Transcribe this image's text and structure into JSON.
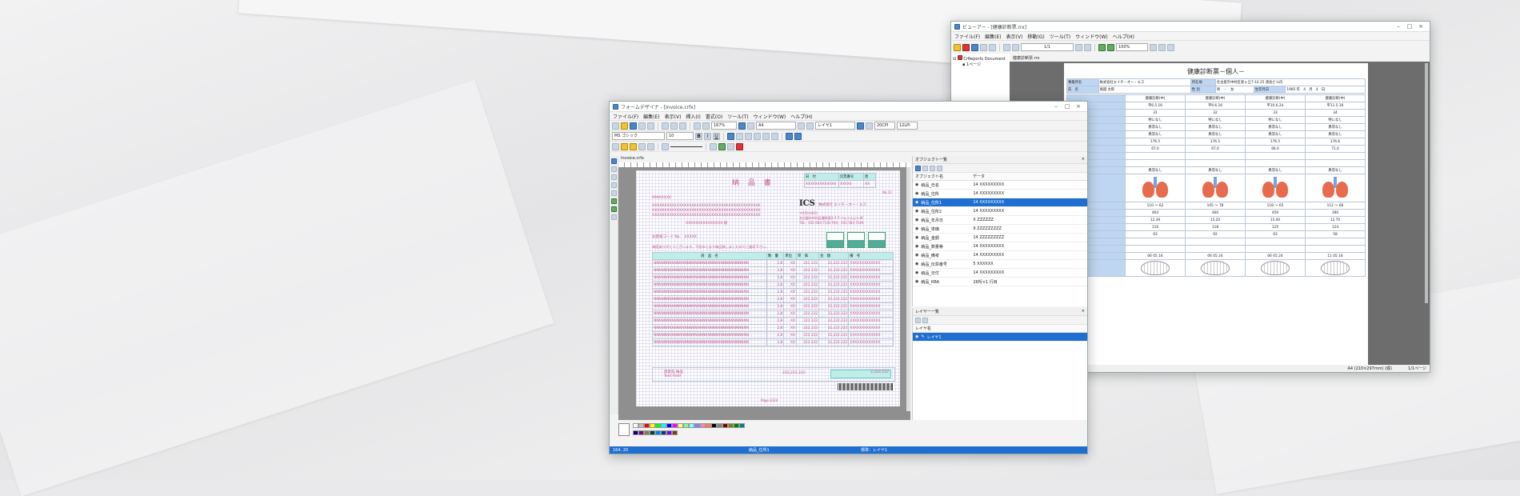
{
  "viewer": {
    "title": "ビューアー - [健康診断票.rrx]",
    "menu": [
      "ファイル(F)",
      "編集(E)",
      "表示(V)",
      "移動(G)",
      "ツール(T)",
      "ウィンドウ(W)",
      "ヘルプ(H)"
    ],
    "page_indicator": "1/1",
    "zoom": "100%",
    "tree_root": "CrReports Document",
    "tree_child": "1ページ",
    "tab": "健康診断票.rrx",
    "doc_title": "健康診断票－個人－",
    "company_label": "事業所名",
    "company": "株式会社エイチ・オー・エス",
    "address_label": "所在地",
    "address": "名古屋市中村区者ヶ丘7-10 25 渡会ビル内",
    "name_label": "氏　名",
    "name": "堀越 太郎",
    "sex_label": "性 別",
    "sex": "男　・　女",
    "birth_label": "生年月日",
    "birth": "1985 年　4　月　4　日",
    "columns": [
      "健康診断(中)",
      "健康診断(中)",
      "健康診断(中)",
      "健康診断(中)"
    ],
    "dates": [
      "平6.5.16",
      "平9.6.16",
      "平10.6.24",
      "平11.5.16"
    ],
    "ages": [
      "31",
      "32",
      "33",
      "34"
    ],
    "nashi": "特になし",
    "ijo": "異常なし",
    "heights": [
      "176.5",
      "176.5",
      "176.5",
      "176.6"
    ],
    "weights": [
      "67.0",
      "67.0",
      "66.0",
      "71.0"
    ],
    "bp": [
      "110 ～ 62",
      "105 ～ 78",
      "118 ～ 65",
      "112 ～ 66"
    ],
    "chol": [
      "464",
      "460",
      "450",
      "390"
    ],
    "tg": [
      "12.39",
      "15.20",
      "15.00",
      "12.70"
    ],
    "ldl": [
      "116",
      "118",
      "125",
      "124"
    ],
    "hdl": [
      "93",
      "92",
      "93",
      "58"
    ],
    "dental_dates": [
      "06 05 16",
      "06 05 24",
      "06 05 24",
      "11 05 16"
    ],
    "status_left": "A4 (210×297mm) (縦)",
    "status_right": "1/1ページ"
  },
  "designer": {
    "title": "フォームデザイナ - [Invoice.crfx]",
    "menu": [
      "ファイル(F)",
      "編集(E)",
      "表示(V)",
      "挿入(I)",
      "書式(O)",
      "ツール(T)",
      "ウィンドウ(W)",
      "ヘルプ(H)"
    ],
    "zoom": "167%",
    "paper": "A4",
    "layer": "レイヤ1",
    "font": "MS ゴシック",
    "font_size": "10",
    "cpi": "20CPI",
    "lpi": "12LPI",
    "tab": "Invoice.crfx",
    "form_title": "納 品 書",
    "header_cols": [
      "日　付",
      "伝票番号",
      "頁"
    ],
    "header_vals": [
      "XXXXXXXXXXXXX",
      "XXXXX",
      "XX"
    ],
    "page_no": "No.12",
    "customer_no": "999XXXXX",
    "xline": "XXXXXXXXXXXXXXXXXXXXXXXXXXXXXXXXXXXXXXXXXXXX",
    "honorific": "XXXXXXXXXXXXXXX 様",
    "logo": "ICS",
    "seller": "株式会社 エイチ・オー・エス",
    "zip": "〒450-0031",
    "seller_addr": "名古屋市中村区種馬東3-7-7 ぺんてんビル4F",
    "tel": "TEL：052-583-7102 FAX：052-583-7104",
    "customer_code_label": "お客様コード No.",
    "customer_code": "XXXXX",
    "thanks": "毎度ありがとうございます。下記のとおり納品致しましたのでご査収下さい。",
    "line_cols": [
      "商　品　名",
      "数　量",
      "単位",
      "単　価",
      "金　額",
      "備　考"
    ],
    "row_item": "NNNNNNNNNNNNNNNNNNNNNNNNNNNNNNNNNNNNN",
    "row_qty": "2,8",
    "row_unit": "XX",
    "row_price": "222.222",
    "row_amount": "22,222.222",
    "row_note": "XXXXXXXXXXXXX",
    "footer_note": "得意先 納品",
    "footer_sub": "Text Field",
    "subtotal": "222,222.222",
    "total": "2,222,222",
    "page_footer": "Page:3/3/4",
    "status_pos": "164, 20",
    "status_mid": "納品_住所1",
    "status_right": "標準：レイヤ1",
    "objects_title": "オブジェクト一覧",
    "objects_header": [
      "オブジェクト名",
      "データ"
    ],
    "objects": [
      {
        "name": "納品_氏名",
        "data": "14 XXXXXXXXX"
      },
      {
        "name": "納品_住所",
        "data": "14 XXXXXXXXX"
      },
      {
        "name": "納品_住所1",
        "data": "14 XXXXXXXXX"
      },
      {
        "name": "納品_住所2",
        "data": "14 XXXXXXXXX"
      },
      {
        "name": "納品_年月日",
        "data": "X ZZZZZZ"
      },
      {
        "name": "納品_単価",
        "data": "9 ZZZZZZZZZ"
      },
      {
        "name": "納品_金額",
        "data": "14 ZZZZZZZZZ"
      },
      {
        "name": "納品_数量等",
        "data": "14 XXXXXXXXX"
      },
      {
        "name": "納品_備考",
        "data": "14 XXXXXXXXX"
      },
      {
        "name": "納品_伝票番号",
        "data": "5 XXXXXX"
      },
      {
        "name": "納品_日付",
        "data": "14 XXXXXXXXX"
      },
      {
        "name": "納品_RBA",
        "data": "26桁×1 行目"
      }
    ],
    "selected_object": 2,
    "layers_title": "レイヤー一覧",
    "layers_header": "レイヤ名",
    "layer_row": "レイヤ1"
  }
}
